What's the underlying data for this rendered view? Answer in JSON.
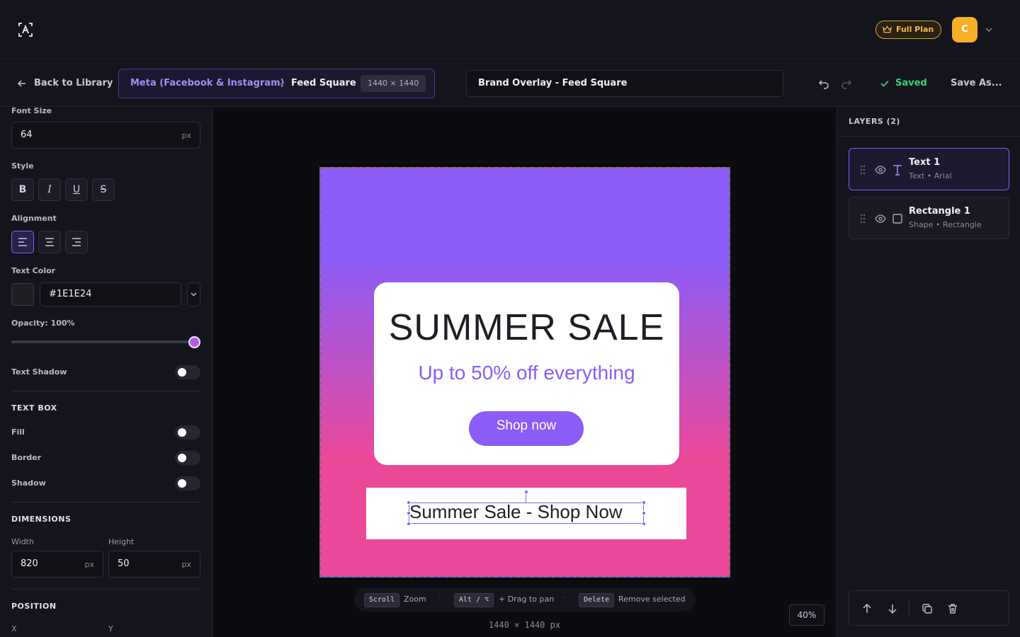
{
  "topbar": {
    "plan_label": "Full Plan",
    "avatar_initial": "C"
  },
  "subbar": {
    "back_label": "Back to Library",
    "platform_name": "Meta (Facebook & Instagram)",
    "format_name": "Feed Square",
    "format_dims": "1440 × 1440",
    "document_name": "Brand Overlay - Feed Square",
    "saved_label": "Saved",
    "save_as_label": "Save As..."
  },
  "properties": {
    "font_size_label": "Font Size",
    "font_size_value": "64",
    "font_size_unit": "px",
    "style_label": "Style",
    "style_buttons": [
      "B",
      "I",
      "U",
      "S"
    ],
    "alignment_label": "Alignment",
    "alignment_active": "left",
    "text_color_label": "Text Color",
    "text_color_value": "#1E1E24",
    "opacity_label": "Opacity: 100%",
    "opacity_value": 1.0,
    "text_shadow_label": "Text Shadow",
    "text_shadow_on": false,
    "text_box_heading": "TEXT BOX",
    "fill_label": "Fill",
    "fill_on": false,
    "border_label": "Border",
    "border_on": false,
    "shadow_label": "Shadow",
    "shadow_on": false,
    "dimensions_heading": "DIMENSIONS",
    "width_label": "Width",
    "width_value": "820",
    "width_unit": "px",
    "height_label": "Height",
    "height_value": "50",
    "height_unit": "px",
    "position_heading": "POSITION",
    "x_label": "X",
    "y_label": "Y"
  },
  "artboard": {
    "card_title": "SUMMER SALE",
    "card_subtitle": "Up to 50% off everything",
    "card_cta": "Shop now",
    "banner_text": "Summer Sale - Shop Now"
  },
  "hints": {
    "scroll_key": "Scroll",
    "scroll_text": "Zoom",
    "pan_key": "Alt / ⌥",
    "pan_text": "+ Drag to pan",
    "delete_key": "Delete",
    "delete_text": "Remove selected",
    "separator": "·"
  },
  "canvas_size_label": "1440 × 1440 px",
  "zoom_label": "40%",
  "layers": {
    "title": "LAYERS (2)",
    "items": [
      {
        "name": "Text 1",
        "meta": "Text • Arial",
        "type": "text",
        "selected": true
      },
      {
        "name": "Rectangle 1",
        "meta": "Shape • Rectangle",
        "type": "shape",
        "selected": false
      }
    ]
  },
  "colors": {
    "accent": "#8b5cf6",
    "gradient_top": "#8b5cf6",
    "gradient_bottom": "#ec4899",
    "saved_green": "#3ad07a",
    "plan_gold": "#f3b94a",
    "avatar_bg": "#f5b026"
  },
  "icons": [
    "logo-icon",
    "crown-icon",
    "chevron-down-icon",
    "arrow-left-icon",
    "undo-icon",
    "redo-icon",
    "check-icon",
    "eye-icon",
    "drag-handle-icon",
    "text-type-icon",
    "rectangle-type-icon",
    "arrow-up-icon",
    "arrow-down-icon",
    "duplicate-icon",
    "trash-icon"
  ]
}
